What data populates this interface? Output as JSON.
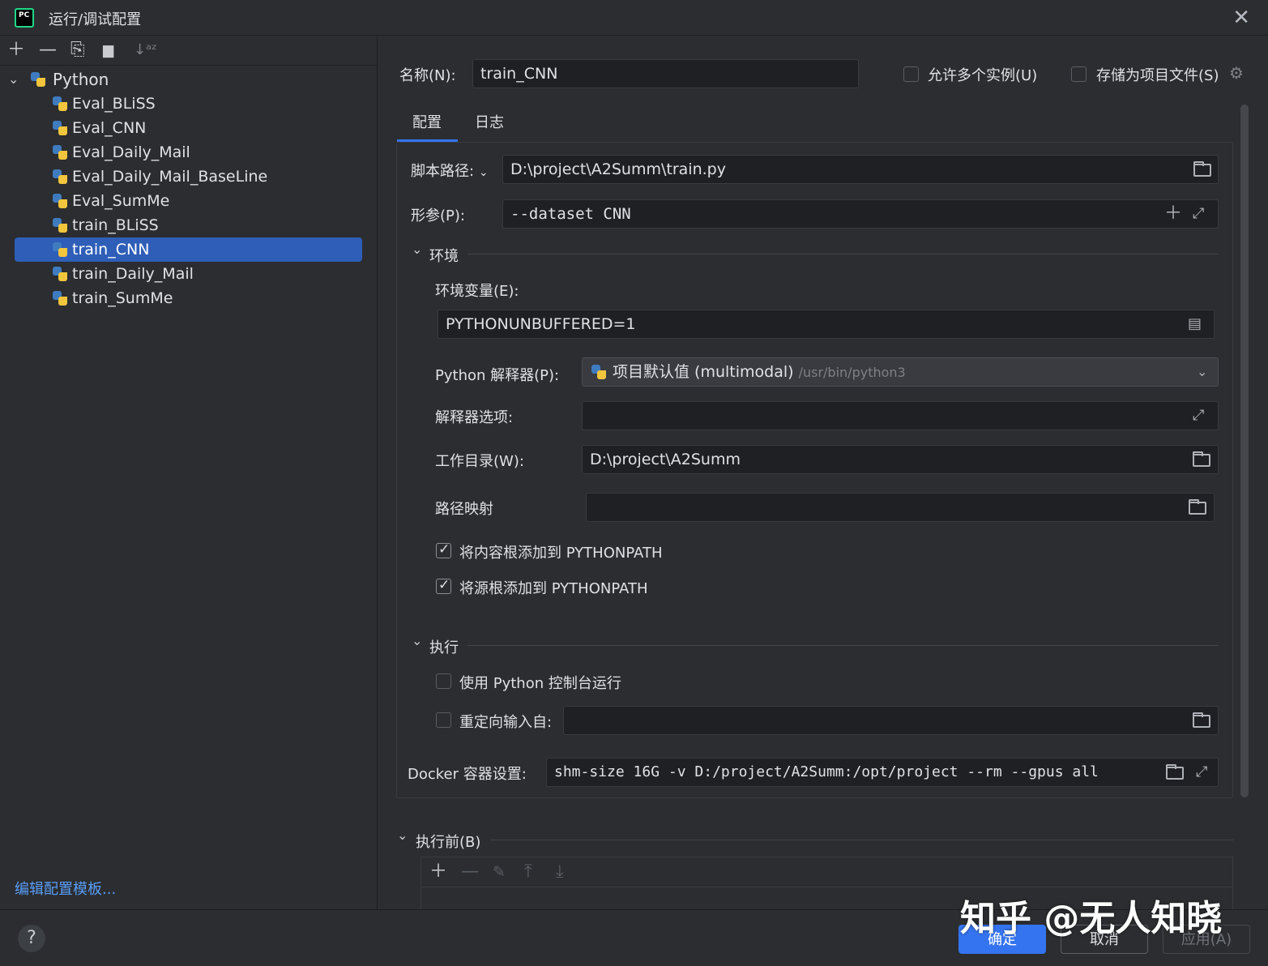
{
  "window": {
    "title": "运行/调试配置",
    "close_glyph": "✕"
  },
  "left_toolbar": {
    "add": "＋",
    "remove": "—",
    "copy": "⎘",
    "folder": "▆",
    "sort": "↓ᵃᶻ"
  },
  "tree": {
    "root_label": "Python",
    "items": [
      {
        "label": "Eval_BLiSS"
      },
      {
        "label": "Eval_CNN"
      },
      {
        "label": "Eval_Daily_Mail"
      },
      {
        "label": "Eval_Daily_Mail_BaseLine"
      },
      {
        "label": "Eval_SumMe"
      },
      {
        "label": "train_BLiSS"
      },
      {
        "label": "train_CNN"
      },
      {
        "label": "train_Daily_Mail"
      },
      {
        "label": "train_SumMe"
      }
    ],
    "selected": "train_CNN"
  },
  "edit_templates_link": "编辑配置模板...",
  "header": {
    "name_label": "名称(N):",
    "name_value": "train_CNN",
    "allow_multiple_label": "允许多个实例(U)",
    "store_as_file_label": "存储为项目文件(S)"
  },
  "tabs": [
    {
      "label": "配置"
    },
    {
      "label": "日志"
    }
  ],
  "config": {
    "script_path_label": "脚本路径:",
    "script_path_value": "D:\\project\\A2Summ\\train.py",
    "params_label": "形参(P):",
    "params_value": "--dataset CNN",
    "env_section": "环境",
    "env_vars_label": "环境变量(E):",
    "env_vars_value": "PYTHONUNBUFFERED=1",
    "interpreter_label": "Python 解释器(P):",
    "interpreter_value": "项目默认值 (multimodal)",
    "interpreter_path": "/usr/bin/python3",
    "interp_options_label": "解释器选项:",
    "interp_options_value": "",
    "workdir_label": "工作目录(W):",
    "workdir_value": "D:\\project\\A2Summ",
    "path_mapping_label": "路径映射",
    "path_mapping_value": "",
    "add_content_roots_label": "将内容根添加到 PYTHONPATH",
    "add_source_roots_label": "将源根添加到 PYTHONPATH",
    "exec_section": "执行",
    "use_console_label": "使用 Python 控制台运行",
    "redirect_input_label": "重定向输入自:",
    "redirect_input_value": "",
    "docker_label": "Docker 容器设置:",
    "docker_value": "shm-size 16G -v D:/project/A2Summ:/opt/project --rm --gpus all"
  },
  "checkboxes": {
    "allow_multiple": false,
    "store_as_file": false,
    "add_content_roots": true,
    "add_source_roots": true,
    "use_console": false,
    "redirect_input": false
  },
  "before_launch": {
    "label": "执行前(B)"
  },
  "buttons": {
    "ok": "确定",
    "cancel": "取消",
    "apply": "应用(A)",
    "help": "?"
  },
  "watermark": "知乎 @无人知晓",
  "colors": {
    "accent": "#3574f0",
    "selection": "#2e5eb8",
    "background": "#2b2d30",
    "field": "#1f2023"
  }
}
